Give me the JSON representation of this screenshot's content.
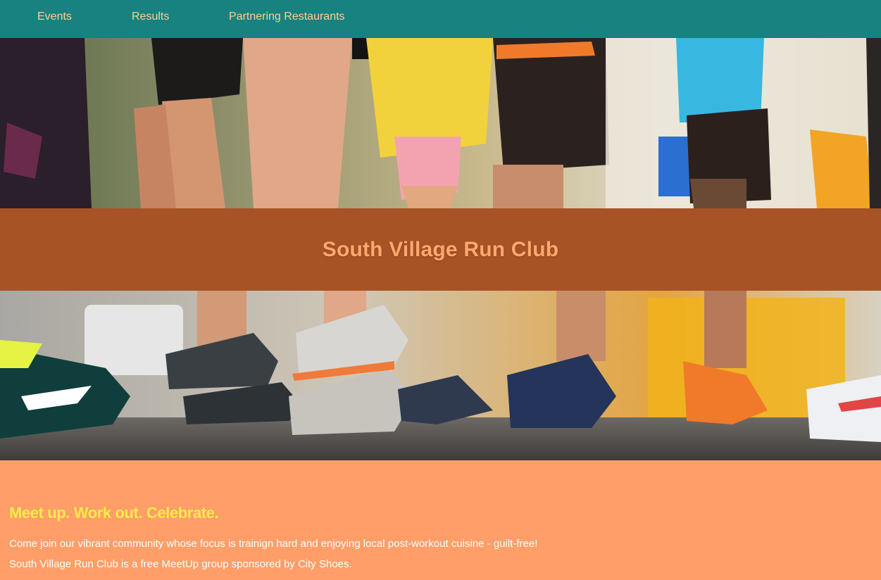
{
  "nav": {
    "items": [
      {
        "label": "Events"
      },
      {
        "label": "Results"
      },
      {
        "label": "Partnering Restaurants"
      }
    ]
  },
  "hero": {
    "top_image": "runners-legs-photo",
    "bottom_image": "running-shoes-photo"
  },
  "header": {
    "title": "South Village Run Club"
  },
  "main": {
    "tagline": "Meet up. Work out. Celebrate.",
    "paragraphs": [
      "Come join our vibrant community whose focus is trainign hard and enjoying local post-workout cuisine - guilt-free!",
      "South Village Run Club is a free MeetUp group sponsored by City Shoes."
    ]
  },
  "colors": {
    "nav_bg": "#17827f",
    "nav_text": "#ffd08c",
    "title_band": "#a75326",
    "title_text": "#ffa86e",
    "content_bg": "#ff9e69",
    "tagline": "#ffeb4a",
    "body_text": "#ffffff"
  }
}
